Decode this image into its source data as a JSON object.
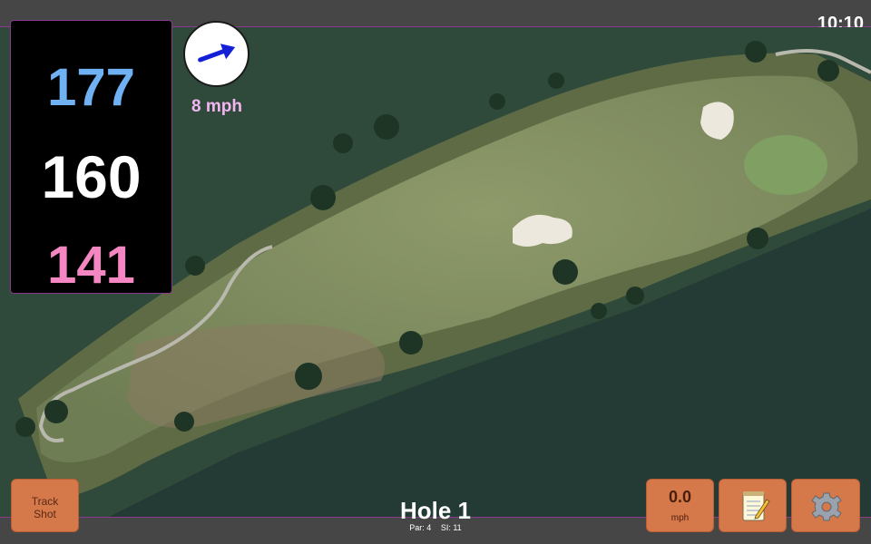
{
  "status_bar": {
    "time": "10:10"
  },
  "distances": {
    "back": "177",
    "middle": "160",
    "front": "141"
  },
  "wind": {
    "speed": "8 mph",
    "direction_icon": "wind-arrow-icon"
  },
  "buttons": {
    "track_shot_line1": "Track",
    "track_shot_line2": "Shot",
    "speed_value": "0.0",
    "speed_unit": "mph",
    "notes_icon": "notepad-icon",
    "settings_icon": "gear-icon"
  },
  "hole": {
    "title": "Hole 1",
    "par": "Par: 4",
    "stroke_index": "SI: 11"
  },
  "colors": {
    "back_distance": "#6fb1f2",
    "middle_distance": "#ffffff",
    "front_distance": "#f487c1",
    "wind_text": "#f3b6f0",
    "button": "#d5784a",
    "accent_border": "#8a3a8e"
  }
}
